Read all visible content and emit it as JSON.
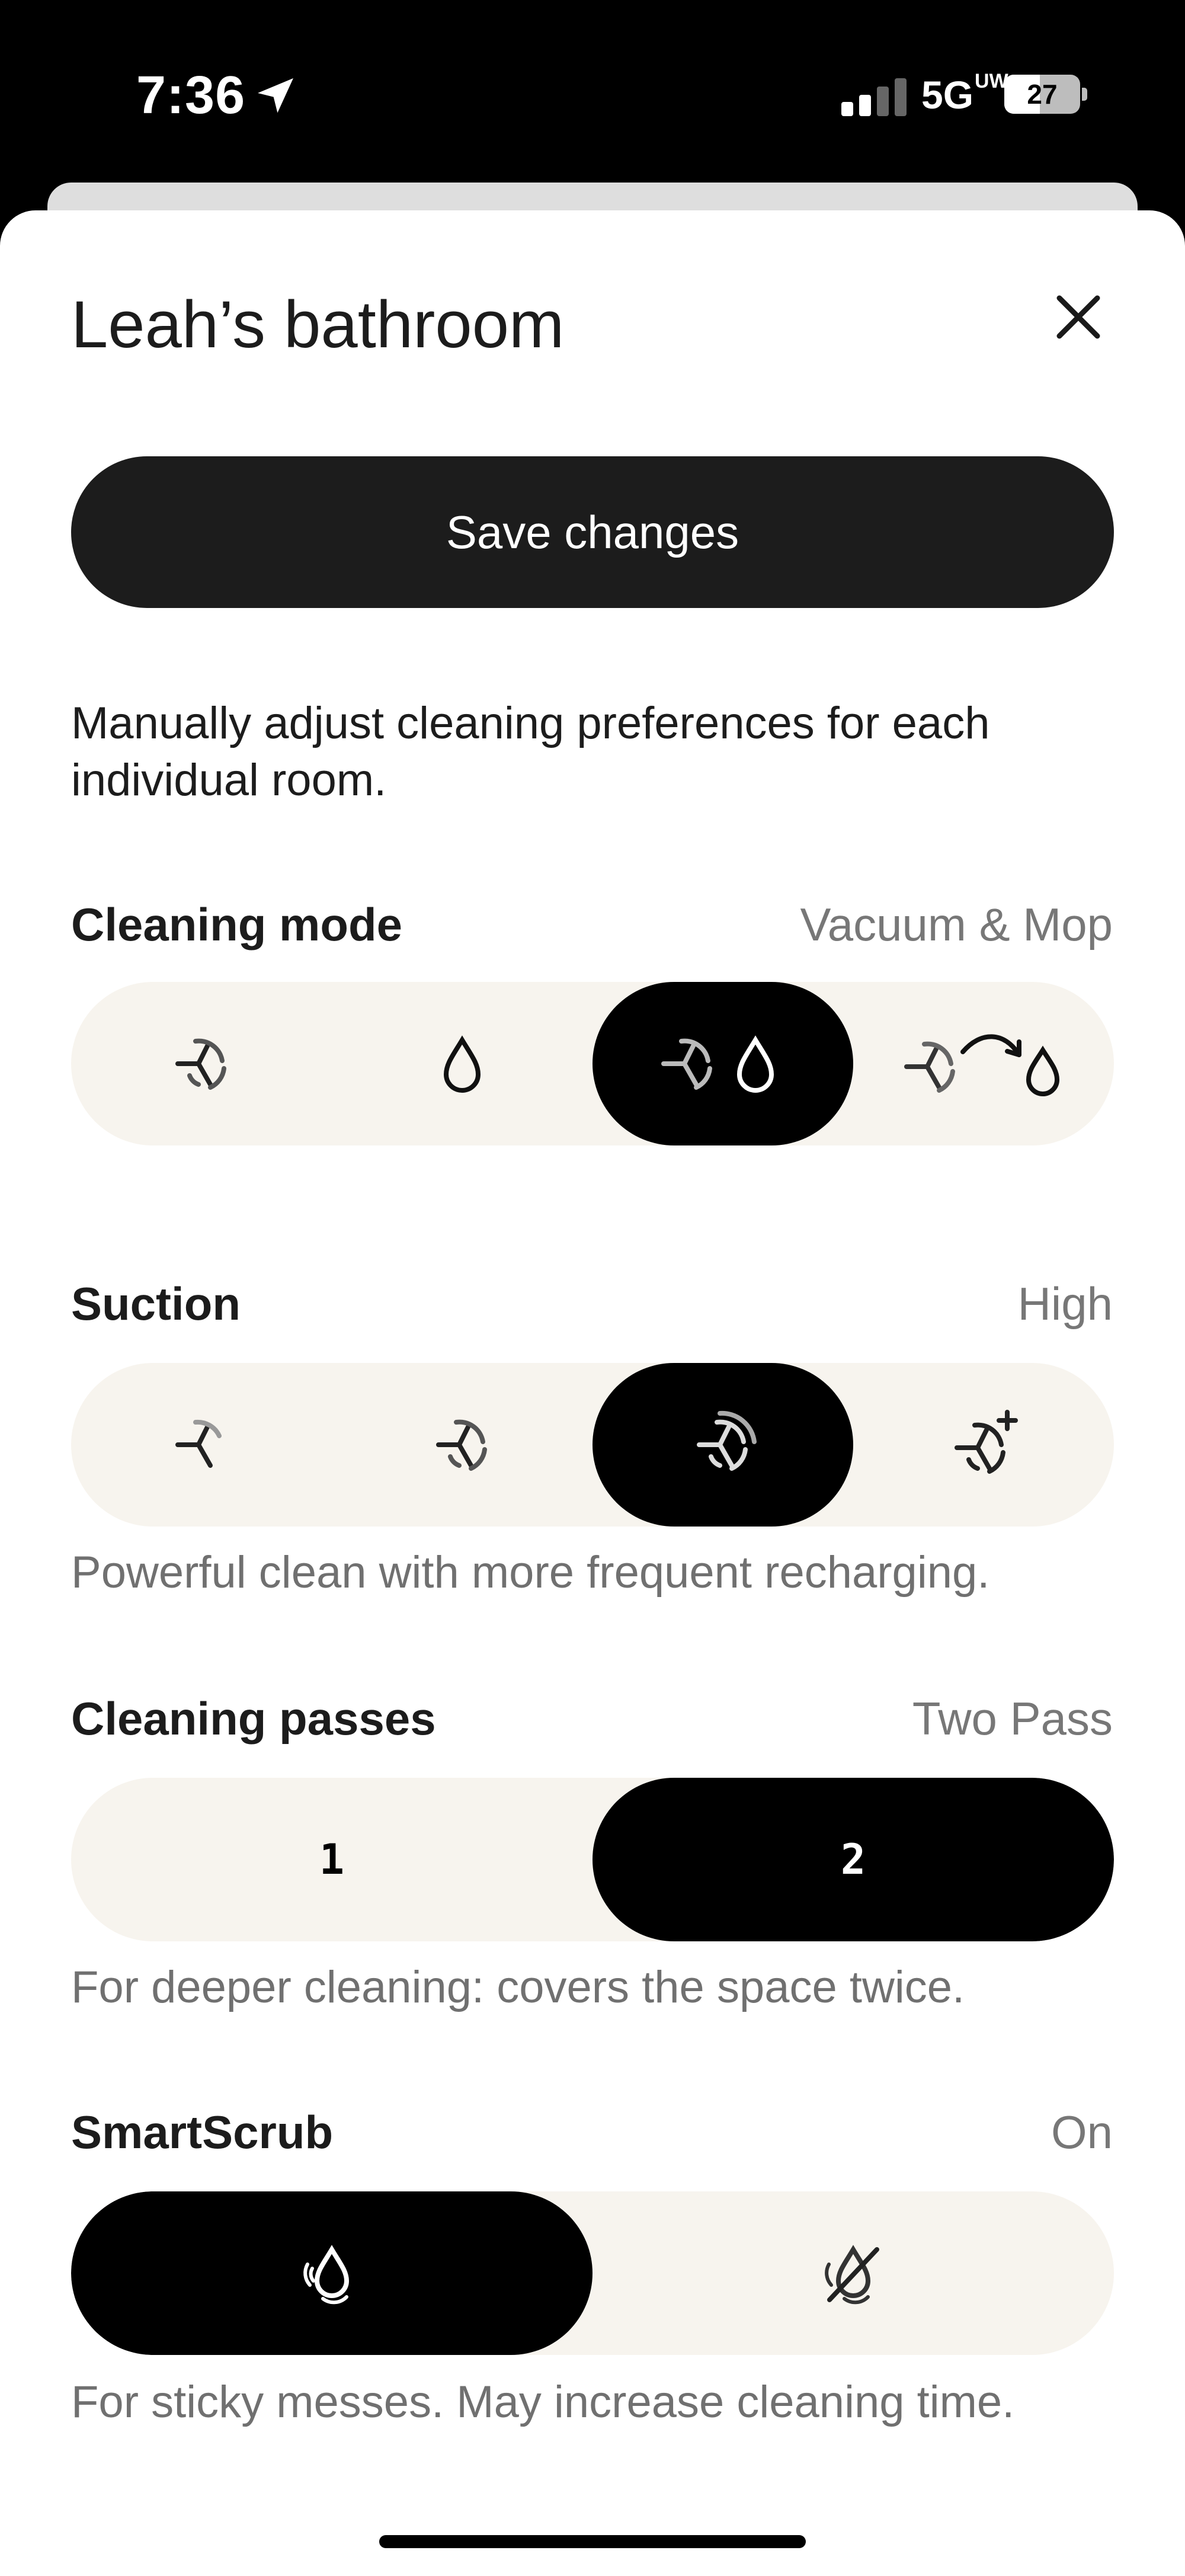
{
  "status_bar": {
    "time": "7:36",
    "network": "5G",
    "network_badge": "UW",
    "battery": "27"
  },
  "sheet": {
    "title": "Leah’s bathroom",
    "save_label": "Save changes",
    "description": "Manually adjust cleaning preferences for each individual room."
  },
  "cleaning_mode": {
    "label": "Cleaning mode",
    "value": "Vacuum & Mop",
    "options": [
      "vacuum-icon",
      "mop-icon",
      "vacuum-and-mop-icon",
      "vacuum-then-mop-icon"
    ],
    "selected_index": 2
  },
  "suction": {
    "label": "Suction",
    "value": "High",
    "caption": "Powerful clean with more frequent recharging.",
    "options": [
      "suction-low-icon",
      "suction-medium-icon",
      "suction-high-icon",
      "suction-max-icon"
    ],
    "selected_index": 2
  },
  "cleaning_passes": {
    "label": "Cleaning passes",
    "value": "Two Pass",
    "caption": "For deeper cleaning: covers the space twice.",
    "options": [
      "1",
      "2"
    ],
    "selected_index": 1
  },
  "smartscrub": {
    "label": "SmartScrub",
    "value": "On",
    "caption": "For sticky messes. May increase cleaning time.",
    "options": [
      "smartscrub-on-icon",
      "smartscrub-off-icon"
    ],
    "selected_index": 0
  },
  "colors": {
    "active": "#000000",
    "track": "#f7f4ee",
    "secondary_text": "#777777"
  }
}
